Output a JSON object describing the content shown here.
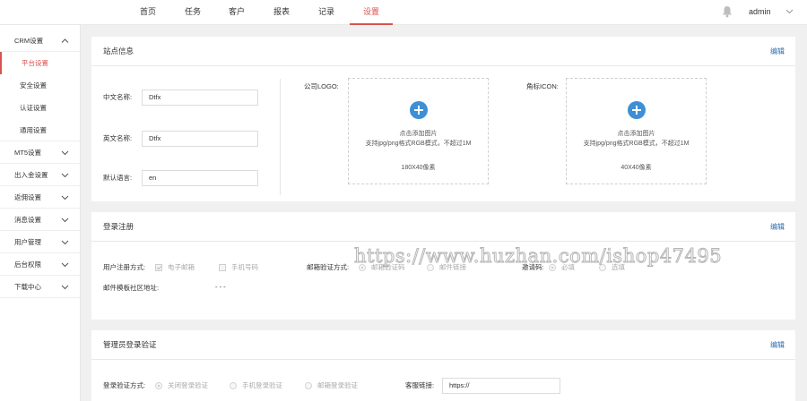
{
  "nav": {
    "items": [
      "首页",
      "任务",
      "客户",
      "报表",
      "记录",
      "设置"
    ],
    "active_index": 5,
    "user": "admin"
  },
  "sidebar": {
    "group_crm": "CRM设置",
    "sub_items": [
      "平台设置",
      "安全设置",
      "认证设置",
      "通用设置"
    ],
    "groups": [
      "MT5设置",
      "出入金设置",
      "返佣设置",
      "消息设置",
      "用户管理",
      "后台权限",
      "下载中心"
    ]
  },
  "site_info": {
    "title": "站点信息",
    "edit": "编辑",
    "cn_name_label": "中文名称:",
    "cn_name_value": "Dtfx",
    "en_name_label": "英文名称:",
    "en_name_value": "Dtfx",
    "lang_label": "默认语言:",
    "lang_value": "en",
    "logo_label": "公司LOGO:",
    "icon_label": "角标ICON:",
    "upload_hint1": "点击添加图片",
    "upload_hint2": "支持jpg/png格式RGB模式，不超过1M",
    "logo_size": "180X40像素",
    "icon_size": "40X40像素"
  },
  "register": {
    "title": "登录注册",
    "edit": "编辑",
    "method_label": "用户注册方式:",
    "method_email": "电子邮箱",
    "method_phone": "手机号码",
    "email_verify_label": "邮箱验证方式:",
    "email_verify_opt1": "邮箱验证码",
    "email_verify_opt2": "邮件链接",
    "invite_label": "邀请码:",
    "invite_opt1": "必填",
    "invite_opt2": "选填",
    "template_label": "邮件模板社区地址:",
    "template_value": "- - -"
  },
  "admin_login": {
    "title": "管理员登录验证",
    "edit": "编辑",
    "verify_label": "登录验证方式:",
    "opt_close": "关闭登录验证",
    "opt_phone": "手机登录验证",
    "opt_email": "邮箱登录验证",
    "service_label": "客服链接:",
    "service_value": "https://"
  },
  "watermark": "https://www.huzhan.com/ishop47495",
  "colors": {
    "accent": "#d9534f",
    "link": "#2a6fb0",
    "upload_plus": "#3d8fd6"
  }
}
